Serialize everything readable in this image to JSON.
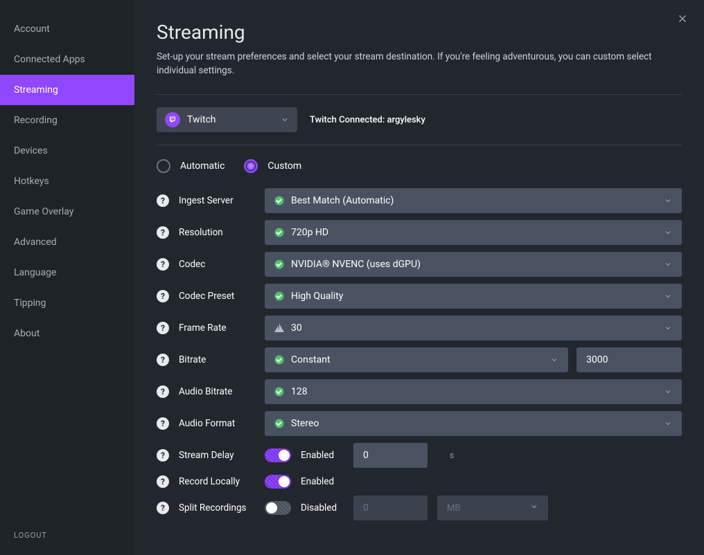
{
  "sidebar": {
    "items": [
      {
        "label": "Account"
      },
      {
        "label": "Connected Apps"
      },
      {
        "label": "Streaming"
      },
      {
        "label": "Recording"
      },
      {
        "label": "Devices"
      },
      {
        "label": "Hotkeys"
      },
      {
        "label": "Game Overlay"
      },
      {
        "label": "Advanced"
      },
      {
        "label": "Language"
      },
      {
        "label": "Tipping"
      },
      {
        "label": "About"
      }
    ],
    "logout": "LOGOUT"
  },
  "header": {
    "title": "Streaming",
    "subtitle": "Set-up your stream preferences and select your stream destination. If you're feeling adventurous, you can custom select individual settings."
  },
  "destination": {
    "selected": "Twitch",
    "connected_label": "Twitch Connected: argylesky"
  },
  "mode": {
    "automatic": "Automatic",
    "custom": "Custom"
  },
  "settings": {
    "help_glyph": "?",
    "ingest": {
      "label": "Ingest Server",
      "value": "Best Match (Automatic)"
    },
    "resolution": {
      "label": "Resolution",
      "value": "720p HD"
    },
    "codec": {
      "label": "Codec",
      "value": "NVIDIA® NVENC (uses dGPU)"
    },
    "preset": {
      "label": "Codec Preset",
      "value": "High Quality"
    },
    "framerate": {
      "label": "Frame Rate",
      "value": "30"
    },
    "bitrate": {
      "label": "Bitrate",
      "mode": "Constant",
      "value": "3000"
    },
    "audio_bitrate": {
      "label": "Audio Bitrate",
      "value": "128"
    },
    "audio_format": {
      "label": "Audio Format",
      "value": "Stereo"
    },
    "delay": {
      "label": "Stream Delay",
      "state": "Enabled",
      "value": "0",
      "unit": "s"
    },
    "record_locally": {
      "label": "Record Locally",
      "state": "Enabled"
    },
    "split": {
      "label": "Split Recordings",
      "state": "Disabled",
      "value": "0",
      "unit": "MB"
    }
  }
}
